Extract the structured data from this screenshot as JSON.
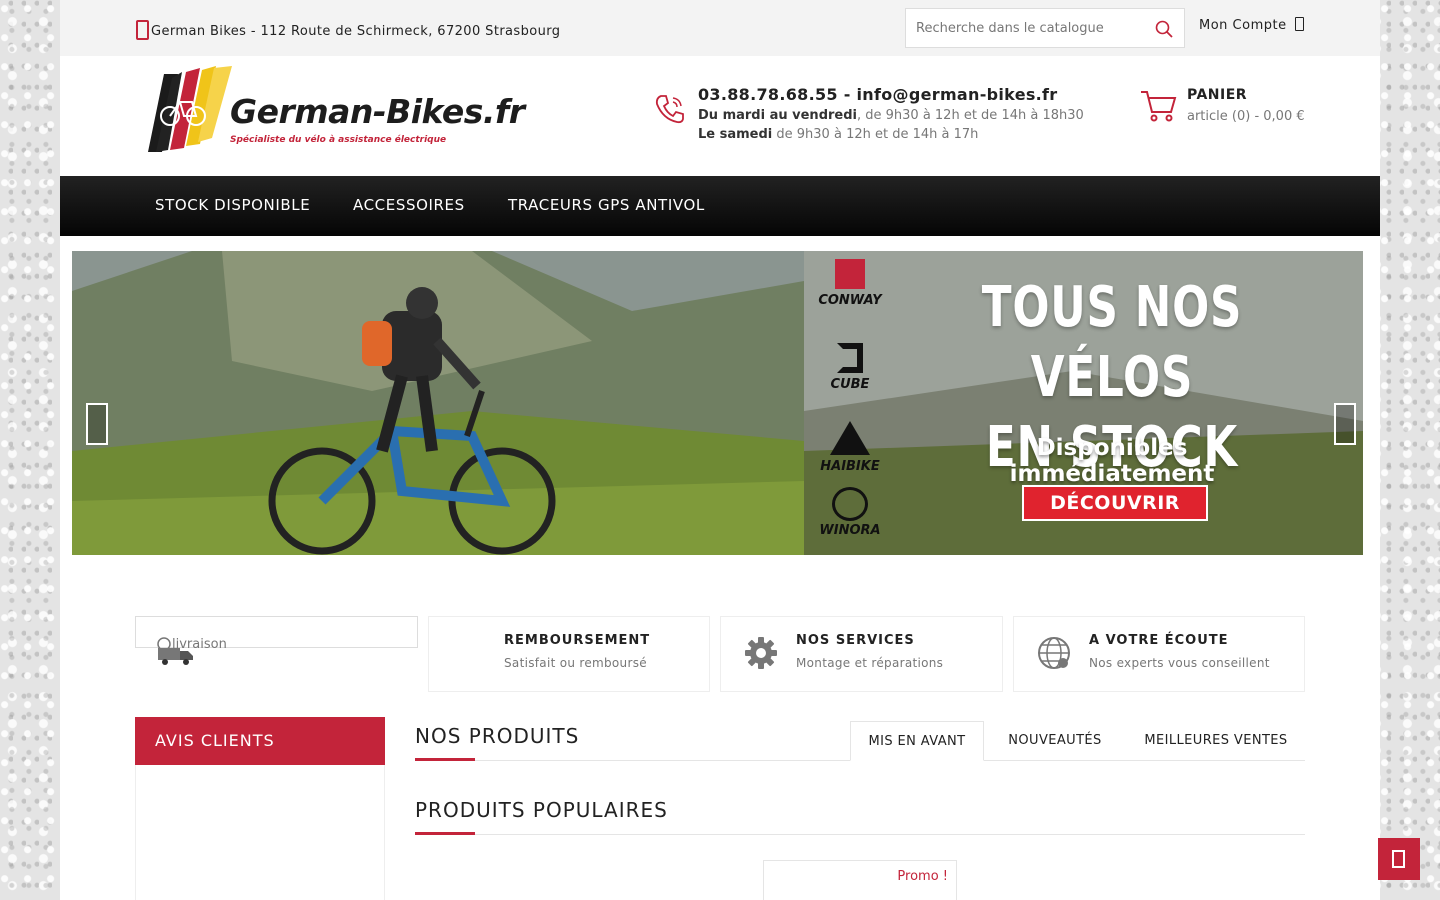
{
  "topbar": {
    "address": "German Bikes - 112 Route de Schirmeck, 67200 Strasbourg",
    "search_placeholder": "Recherche dans le catalogue",
    "account_label": "Mon Compte"
  },
  "header": {
    "logo_text": "German-Bikes.fr",
    "logo_tagline": "Spécialiste du vélo à assistance électrique",
    "contact_line": "03.88.78.68.55 - info@german-bikes.fr",
    "hours_week_bold": "Du mardi au vendredi",
    "hours_week": ", de 9h30 à 12h et de 14h à 18h30",
    "hours_sat_bold": "Le samedi",
    "hours_sat": " de 9h30 à 12h et de 14h à 17h",
    "cart_title": "PANIER",
    "cart_info": "article (0) - 0,00 €"
  },
  "nav": {
    "items": [
      {
        "label": "STOCK DISPONIBLE"
      },
      {
        "label": "ACCESSOIRES"
      },
      {
        "label": "TRACEURS GPS ANTIVOL"
      }
    ]
  },
  "banner": {
    "headline_1": "TOUS NOS VÉLOS",
    "headline_2": "EN STOCK",
    "subtitle": "Disponibles immédiatement",
    "cta": "DÉCOUVRIR",
    "brands": [
      "CONWAY",
      "CUBE",
      "HAIBIKE",
      "WINORA"
    ]
  },
  "reassurance": [
    {
      "title": "",
      "subtitle": "",
      "alt": "livraison"
    },
    {
      "title": "REMBOURSEMENT",
      "subtitle": "Satisfait ou remboursé"
    },
    {
      "title": "NOS SERVICES",
      "subtitle": "Montage et réparations"
    },
    {
      "title": "A VOTRE ÉCOUTE",
      "subtitle": "Nos experts vous conseillent"
    }
  ],
  "sidebar": {
    "avis_title": "AVIS CLIENTS"
  },
  "products": {
    "section_title": "NOS PRODUITS",
    "tabs": [
      {
        "label": "MIS EN AVANT",
        "active": true
      },
      {
        "label": "NOUVEAUTÉS"
      },
      {
        "label": "MEILLEURES VENTES"
      }
    ],
    "popular_title": "PRODUITS POPULAIRES",
    "promo_badge": "Promo !"
  },
  "colors": {
    "accent": "#c3243a",
    "nav_bg": "#111111"
  }
}
